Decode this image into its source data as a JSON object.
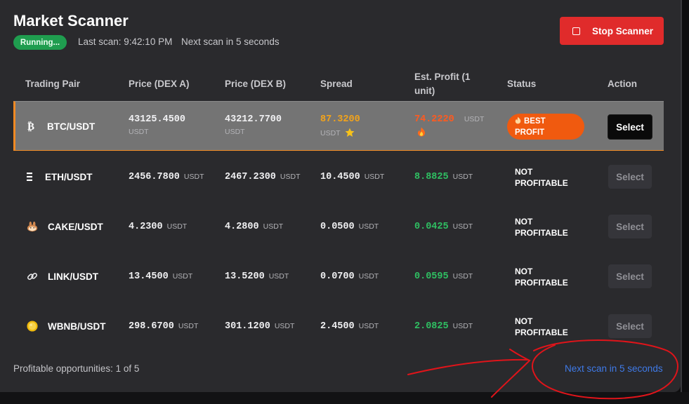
{
  "header": {
    "title": "Market Scanner",
    "running_badge": "Running...",
    "last_scan": "Last scan: 9:42:10 PM",
    "next_scan": "Next scan in 5 seconds",
    "stop_button": "Stop Scanner"
  },
  "columns": {
    "pair": "Trading Pair",
    "price_a": "Price (DEX A)",
    "price_b": "Price (DEX B)",
    "spread": "Spread",
    "profit_line1": "Est. Profit (1",
    "profit_line2": "unit)",
    "status": "Status",
    "action": "Action"
  },
  "rows": [
    {
      "pair": "BTC/USDT",
      "icon": "bitcoin-icon",
      "price_a": "43125.4500",
      "price_b": "43212.7700",
      "spread": "87.3200",
      "profit": "74.2220",
      "unit": "USDT",
      "status_line1": "BEST",
      "status_line2": "PROFIT",
      "action": "Select"
    },
    {
      "pair": "ETH/USDT",
      "icon": "ethereum-icon",
      "price_a": "2456.7800",
      "price_b": "2467.2300",
      "spread": "10.4500",
      "profit": "8.8825",
      "unit": "USDT",
      "status_line1": "NOT",
      "status_line2": "PROFITABLE",
      "action": "Select"
    },
    {
      "pair": "CAKE/USDT",
      "icon": "pancake-bunny-icon",
      "price_a": "4.2300",
      "price_b": "4.2800",
      "spread": "0.0500",
      "profit": "0.0425",
      "unit": "USDT",
      "status_line1": "NOT",
      "status_line2": "PROFITABLE",
      "action": "Select"
    },
    {
      "pair": "LINK/USDT",
      "icon": "chain-link-icon",
      "price_a": "13.4500",
      "price_b": "13.5200",
      "spread": "0.0700",
      "profit": "0.0595",
      "unit": "USDT",
      "status_line1": "NOT",
      "status_line2": "PROFITABLE",
      "action": "Select"
    },
    {
      "pair": "WBNB/USDT",
      "icon": "bnb-coin-icon",
      "price_a": "298.6700",
      "price_b": "301.1200",
      "spread": "2.4500",
      "profit": "2.0825",
      "unit": "USDT",
      "status_line1": "NOT",
      "status_line2": "PROFITABLE",
      "action": "Select"
    }
  ],
  "footer": {
    "opportunities": "Profitable opportunities: 1 of 5",
    "next_scan": "Next scan in 5 seconds"
  },
  "colors": {
    "accent_red": "#e02b2b",
    "running_green": "#1f9d4f",
    "best_orange": "#f05a0f",
    "profit_green": "#2fbf62",
    "annotation_red": "#e0141a"
  }
}
